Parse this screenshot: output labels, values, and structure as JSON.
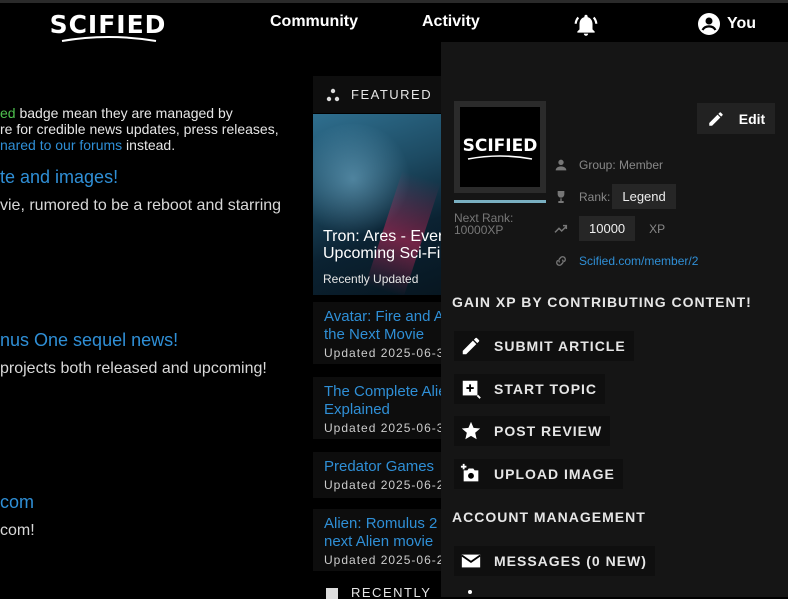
{
  "nav": {
    "logo_text": "SCIFIED",
    "community": "Community",
    "activity": "Activity",
    "you": "You"
  },
  "left": {
    "line1_green": "ed",
    "line1_rest": " badge mean they are managed by",
    "line2": "re for credible news updates, press releases,",
    "line3_link": "nared to our forums",
    "line3_rest": " instead.",
    "head1": "te and images!",
    "body1": "vie, rumored to be a reboot and starring",
    "head2": "nus One sequel news!",
    "body2": " projects both released and upcoming!",
    "head3": "com",
    "body3": "com!"
  },
  "featured": {
    "tab_label": "FEATURED",
    "hero_title": "Tron: Ares - Ever Upcoming Sci-Fi",
    "hero_sub": "Recently Updated",
    "items": [
      {
        "title": "Avatar: Fire and Ash",
        "title2": "the Next Movie",
        "date": "Updated 2025-06-3"
      },
      {
        "title": "The Complete Alien",
        "title2": "Explained",
        "date": "Updated 2025-06-3"
      },
      {
        "title": "Predator Games",
        "title2": "",
        "date": "Updated 2025-06-2"
      },
      {
        "title": "Alien: Romulus 2",
        "title2": "next Alien movie",
        "date": "Updated 2025-06-2"
      }
    ],
    "recent_label": "RECENTLY"
  },
  "panel": {
    "avatar_text": "SCIFIED",
    "edit_label": "Edit",
    "group": "Group: Member",
    "rank_label": "Rank:",
    "rank_value": "Legend",
    "next_rank_1": "Next Rank:",
    "next_rank_2": "10000XP",
    "xp_value": "10000",
    "xp_unit": "XP",
    "profile_url": "Scified.com/member/2",
    "section_xp": "GAIN XP BY CONTRIBUTING CONTENT!",
    "actions": [
      {
        "label": "SUBMIT ARTICLE",
        "icon": "pencil-icon"
      },
      {
        "label": "START TOPIC",
        "icon": "add-box-icon"
      },
      {
        "label": "POST REVIEW",
        "icon": "star-icon"
      },
      {
        "label": "UPLOAD IMAGE",
        "icon": "add-photo-icon"
      }
    ],
    "section_account": "ACCOUNT MANAGEMENT",
    "messages": "MESSAGES (0 NEW)"
  },
  "colors": {
    "link": "#2f8fd6",
    "green": "#4ec14e",
    "panel_bg": "#151515"
  }
}
